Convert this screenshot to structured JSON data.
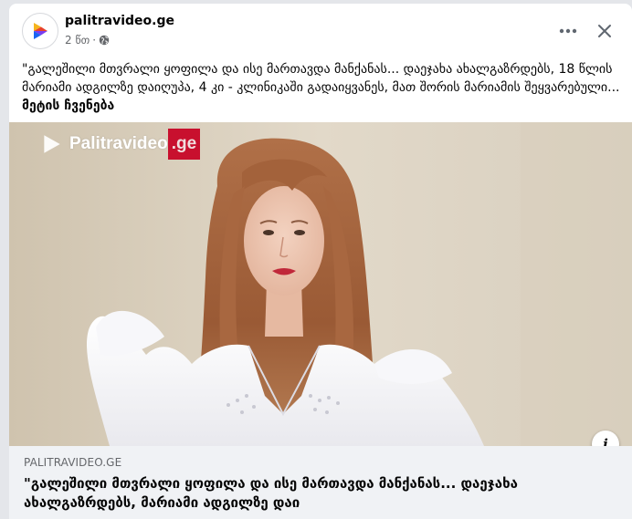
{
  "post": {
    "page_name": "palitravideo.ge",
    "time": "2 წთ",
    "separator": "·",
    "caption": "\"გალეშილი მთვრალი ყოფილა და ისე მართავდა მანქანას... დაეჯახა ახალგაზრდებს, 18 წლის მარიამი ადგილზე დაიღუპა, 4 კი - კლინიკაში გადაიყვანეს, მათ შორის მარიამის შეყვარებული...",
    "see_more": "მეტის ჩვენება"
  },
  "media": {
    "watermark_brand": "Palitravideo",
    "watermark_suffix": ".ge",
    "info_label": "i"
  },
  "link_preview": {
    "domain": "PALITRAVIDEO.GE",
    "title": "\"გალეშილი მთვრალი ყოფილა და ისე მართავდა მანქანას... დაეჯახა ახალგაზრდებს, მარიამი ადგილზე დაი"
  },
  "icons": {
    "avatar": "palitravideo-logo",
    "globe": "globe-icon",
    "more": "more-options-icon",
    "close": "close-icon",
    "info": "info-icon"
  },
  "colors": {
    "brand_red": "#c8102e",
    "brand_yellow": "#f6b51e",
    "brand_blue": "#1b64f2",
    "brand_purple": "#7a3df0"
  }
}
